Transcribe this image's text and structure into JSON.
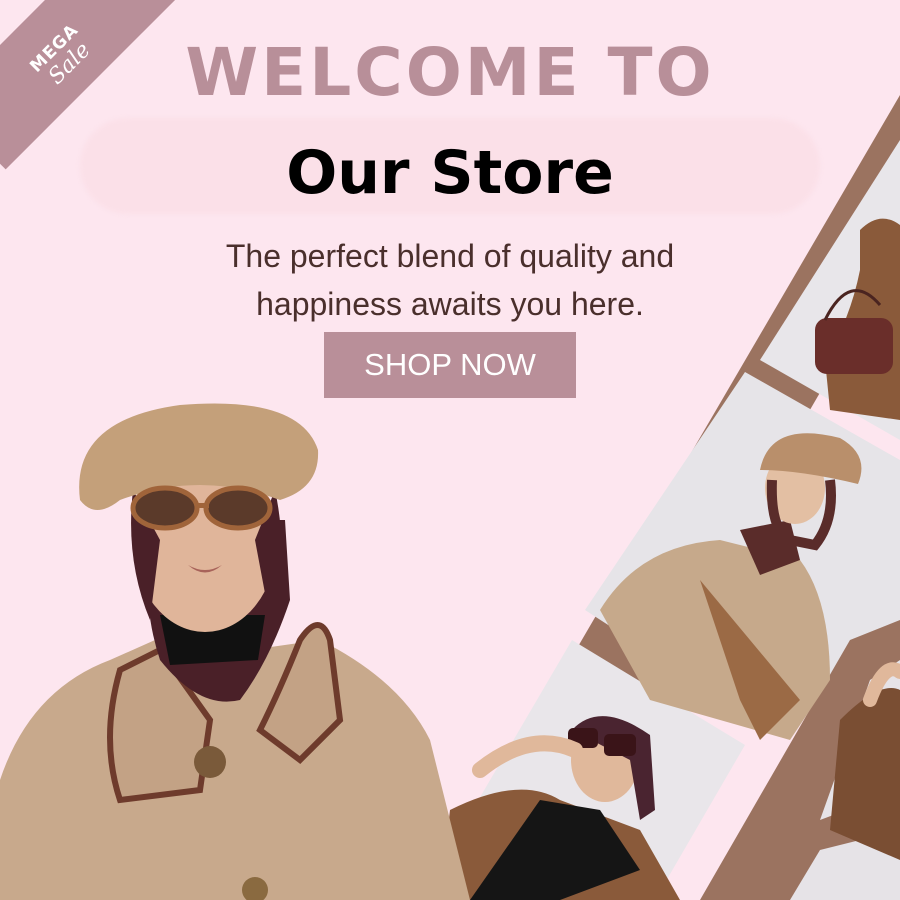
{
  "badge": {
    "line1": "MEGA",
    "line2": "Sale"
  },
  "hero": {
    "welcome": "WELCOME TO",
    "title": "Our Store",
    "tagline_line1": "The perfect blend of quality and",
    "tagline_line2": "happiness awaits you here.",
    "cta": "SHOP NOW"
  },
  "colors": {
    "background": "#fde6ef",
    "accent": "#b98f99",
    "title": "#000000",
    "tagline": "#4a2f2c",
    "filmstrip": "#9b7360"
  }
}
